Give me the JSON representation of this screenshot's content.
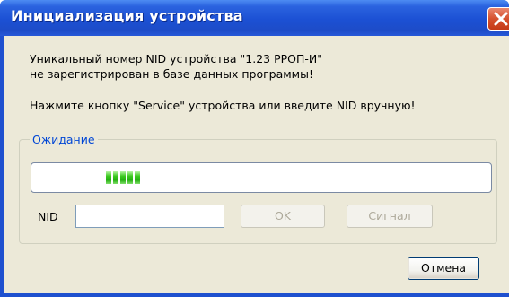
{
  "window": {
    "title": "Инициализация устройства"
  },
  "message": {
    "line1": "Уникальный номер NID устройства \"1.23 РРОП-И\"",
    "line2": "не зарегистрирован в базе данных программы!",
    "line3": "Нажмите кнопку \"Service\" устройства или введите NID вручную!"
  },
  "waiting_group": {
    "label": "Ожидание",
    "progress_segments": 5
  },
  "nid": {
    "label": "NID",
    "value": ""
  },
  "buttons": {
    "ok": "OK",
    "signal": "Сигнал",
    "cancel": "Отмена"
  },
  "colors": {
    "title_bar": "#1d4cc8",
    "group_label": "#0046d5",
    "progress_fill": "#26b012",
    "close_button": "#d5512e"
  },
  "icons": {
    "close": "close-icon"
  }
}
